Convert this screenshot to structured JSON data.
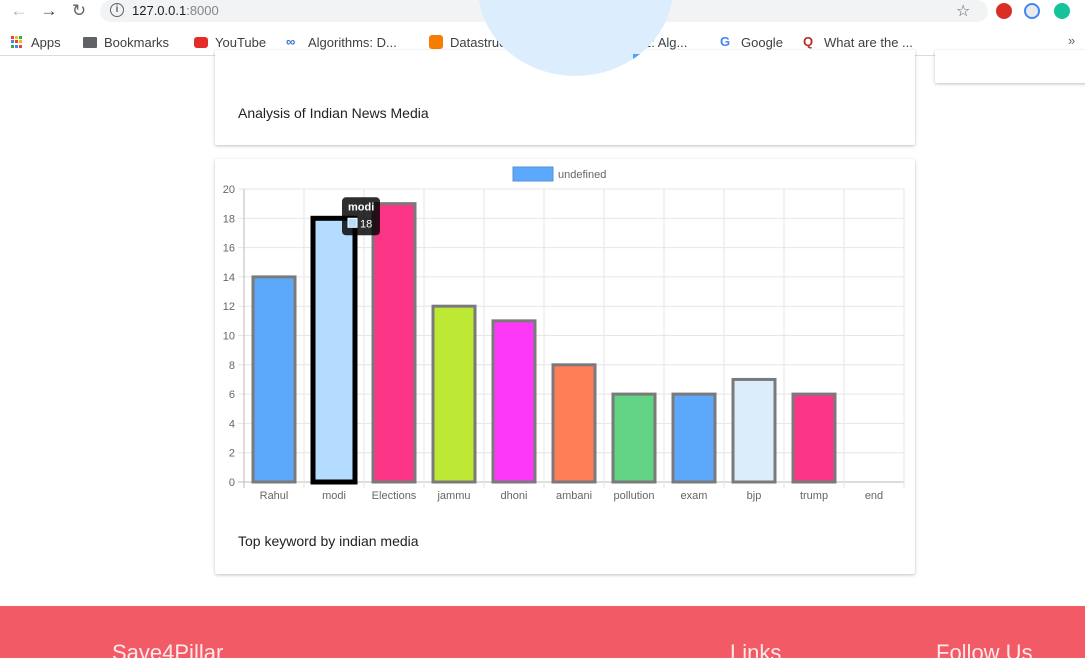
{
  "browser": {
    "url_host": "127.0.0.1",
    "url_port": ":8000",
    "bookmarks": [
      {
        "label": "Apps",
        "icon": "apps-grid-icon"
      },
      {
        "label": "Bookmarks",
        "icon": "folder-icon"
      },
      {
        "label": "YouTube",
        "icon": "youtube-icon"
      },
      {
        "label": "Algorithms: D...",
        "icon": "coursera-icon"
      },
      {
        "label": "Datastructure...",
        "icon": "blogger-icon"
      },
      {
        "label": "Lecture 1: Alg...",
        "icon": "mit-ocw-icon"
      },
      {
        "label": "Google",
        "icon": "google-icon"
      },
      {
        "label": "What are the ...",
        "icon": "quora-icon"
      }
    ],
    "more_label": "»"
  },
  "cards": {
    "news_caption": "Analysis of Indian News Media",
    "keyword_caption": "Top keyword by indian media"
  },
  "chart_data": {
    "type": "bar",
    "legend": "undefined",
    "legend_color": "#5ca8fb",
    "categories": [
      "Rahul",
      "modi",
      "Elections",
      "jammu",
      "dhoni",
      "ambani",
      "pollution",
      "exam",
      "bjp",
      "trump",
      "end"
    ],
    "values": [
      14,
      18,
      19,
      12,
      11,
      8,
      6,
      6,
      7,
      6,
      0
    ],
    "colors": [
      "#5ca8fb",
      "#b3dcfe",
      "#fd3587",
      "#bde934",
      "#fd39f7",
      "#fe7e57",
      "#63d386",
      "#5ca8fb",
      "#dbedfb",
      "#fd3587",
      "#5ca8fb"
    ],
    "ylim": [
      0,
      20
    ],
    "yticks": [
      "0",
      "2",
      "4",
      "6",
      "8",
      "10",
      "12",
      "14",
      "16",
      "18",
      "20"
    ],
    "grid": true,
    "legend_position": "top",
    "highlighted": "modi",
    "tooltip": {
      "title": "modi",
      "value": "18"
    }
  },
  "footer": {
    "brand": "Save4Pillar",
    "links": "Links",
    "follow": "Follow Us"
  }
}
